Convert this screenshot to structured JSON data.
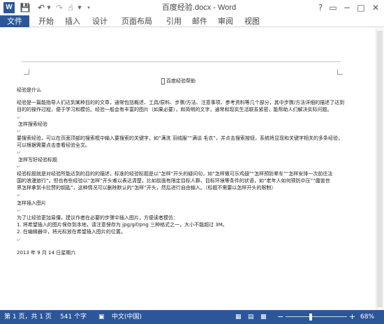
{
  "window": {
    "title": "百度经验.docx - Word"
  },
  "quick_access": {
    "app_icon": "W",
    "save_icon": "save-icon",
    "undo_icon": "undo-icon",
    "redo_icon": "redo-icon",
    "touch_icon": "touch-mode-icon",
    "customize_icon": "customize-qat-icon"
  },
  "window_controls": {
    "help": "?",
    "ribbon_options": "▭",
    "minimize": "−",
    "maximize": "□",
    "close": "✕"
  },
  "ribbon_tabs": [
    "文件",
    "开始",
    "插入",
    "设计",
    "页面布局",
    "引用",
    "邮件",
    "审阅",
    "视图"
  ],
  "document": {
    "heading": "百度经验帮助",
    "lines": [
      "经验是什么",
      "经验是一篇能指导人们达到某种目的的文章，通常包括概述、工具/原料、步骤/方法、注意事项、参考资料等几个部分，其中步骤/方法详细的描述了达到",
      "目的的操作过程，便于学习和模仿。经验一般会有丰富的图片（如果必要），和简明的文字，通常和现实生活联系紧密，能帮助人们解决实际问题。",
      "怎样搜索经验",
      "要搜索经验，可以在页面顶部的搜索框中输入要搜索的关键字，如“满洗 羽绒服”“满谈 毛衣”，并点击搜索按钮，系统将显现和关键字相关的多条经验，",
      "可以根据需要点击查看经验全文。",
      "怎样写好经验标题",
      "经验标题就是对经验所能达到的目的的描述，标准的经验标题是以“怎样”开头的疑问句，如“怎样做可乐鸡翅”“怎样预防晕车”“怎样安排一次前往法",
      "国的浪漫旅行”。但也有些经验以“怎样”开头难以表达清楚，比如前面有限定目标人群、目标环境等条件的状语，如“老年人如何预防中压”“魔兽世",
      "界怎样拿到卡拉赞的钥匙”，这种情况可以删除默认的“怎样”开头，然后进行自由输入。（标题不需要以怎样开头的限制）",
      "怎样插入图片",
      "为了让经验更加易懂，建议作者在必要的步骤中插入图片，方便读者模仿：",
      "1. 将希望插入的图片保存到本地，请注意保存为 jpg/gif/png 三种格式之一，大小不能超过 3M。",
      "2. 在编辑器中，将光标放在希望插入图片的位置。",
      "2013 年 9 月 14 日星期六"
    ]
  },
  "status_bar": {
    "page": "第 1 页，共 1 页",
    "words": "541 个字",
    "proofing_icon": "proofing-icon",
    "language": "中文(中国)",
    "zoom": "68%",
    "zoom_level": 0.68
  }
}
